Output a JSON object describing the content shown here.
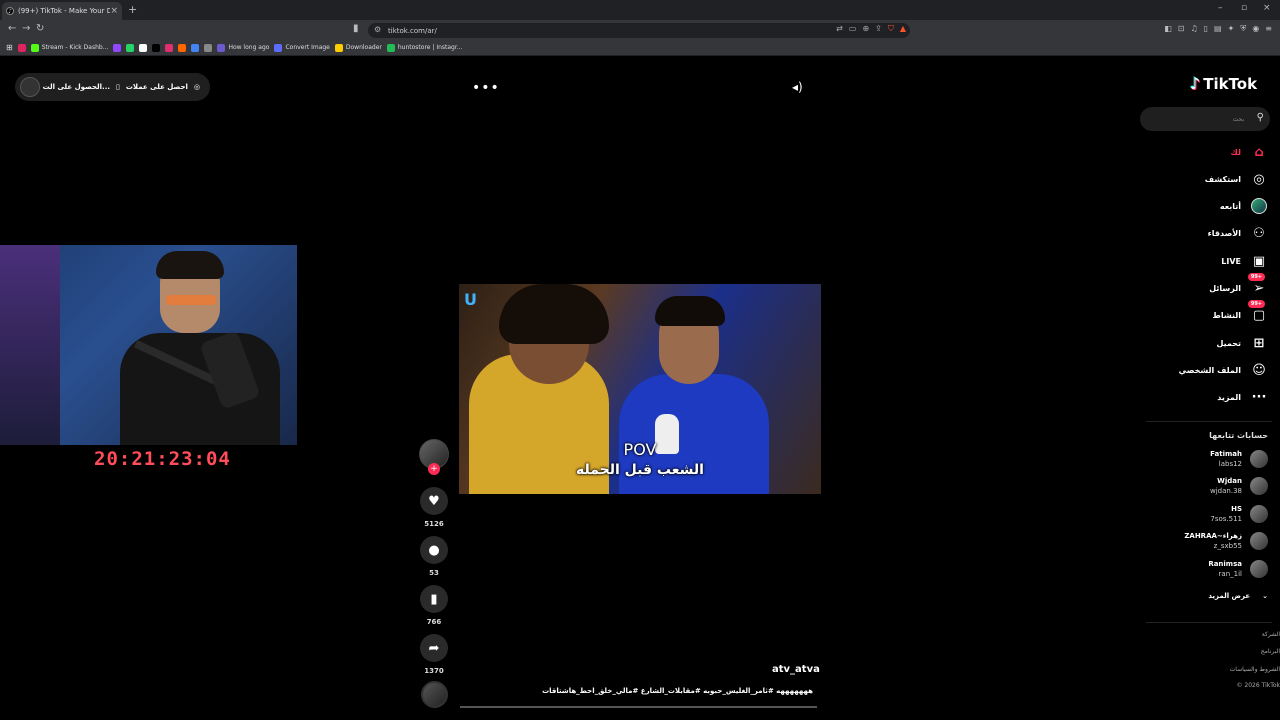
{
  "browser": {
    "tab_title": "(99+) TikTok - Make Your Day",
    "url": "tiktok.com/ar/",
    "bookmarks": [
      {
        "label": "",
        "color": "#e0245e"
      },
      {
        "label": "Stream - Kick Dashb...",
        "color": "#53fc18"
      },
      {
        "label": "",
        "color": "#9146ff"
      },
      {
        "label": "",
        "color": "#25d366"
      },
      {
        "label": "",
        "color": "#ffffff"
      },
      {
        "label": "",
        "color": "#000000"
      },
      {
        "label": "",
        "color": "#e1306c"
      },
      {
        "label": "",
        "color": "#ff6600"
      },
      {
        "label": "",
        "color": "#4285f4"
      },
      {
        "label": "",
        "color": "#888888"
      },
      {
        "label": "How long ago",
        "color": "#6a5acd"
      },
      {
        "label": "Convert Image",
        "color": "#5b6cff"
      },
      {
        "label": "Downloader",
        "color": "#ffcc00"
      },
      {
        "label": "huntostore | Instagr...",
        "color": "#22bb55"
      }
    ]
  },
  "overlay": {
    "coins_text": "احصل على عملات",
    "coins_text2": "الحصول على الت...",
    "clock": "20:21:23:04"
  },
  "video": {
    "caption_top": "POV",
    "caption_bottom": "الشعب قبل الحمله",
    "username": "atv_atva",
    "description": "هههههههه #ثامر_الغليس_حبوبه #مقابلات_الشارع #مالي_خلق_احط_هاشتاقات"
  },
  "actions": {
    "likes": "5126",
    "comments": "53",
    "saves": "766",
    "shares": "1370"
  },
  "sidebar": {
    "logo": "TikTok",
    "search_placeholder": "بحث",
    "nav": [
      {
        "label": "لك",
        "icon": "home-icon",
        "glyph": "⌂",
        "active": true,
        "badge": ""
      },
      {
        "label": "استكشف",
        "icon": "compass-icon",
        "glyph": "◎",
        "active": false,
        "badge": ""
      },
      {
        "label": "أتابعه",
        "icon": "avatar-icon",
        "glyph": "",
        "active": false,
        "badge": ""
      },
      {
        "label": "الأصدقاء",
        "icon": "friends-icon",
        "glyph": "⚇",
        "active": false,
        "badge": ""
      },
      {
        "label": "LIVE",
        "icon": "live-icon",
        "glyph": "▣",
        "active": false,
        "badge": ""
      },
      {
        "label": "الرسائل",
        "icon": "messages-icon",
        "glyph": "➢",
        "active": false,
        "badge": "99+"
      },
      {
        "label": "النشاط",
        "icon": "activity-icon",
        "glyph": "▢",
        "active": false,
        "badge": "99+"
      },
      {
        "label": "تحميل",
        "icon": "upload-icon",
        "glyph": "⊞",
        "active": false,
        "badge": ""
      },
      {
        "label": "الملف الشخصي",
        "icon": "profile-icon",
        "glyph": "☺",
        "active": false,
        "badge": ""
      },
      {
        "label": "المزيد",
        "icon": "more-icon",
        "glyph": "···",
        "active": false,
        "badge": ""
      }
    ],
    "following_title": "حسابات تتابعها",
    "following": [
      {
        "name": "Fatimah",
        "handle": "labs12"
      },
      {
        "name": "Wjdan",
        "handle": "wjdan.38"
      },
      {
        "name": "HS",
        "handle": "7sos.511"
      },
      {
        "name": "ZAHRAA~زهراء",
        "handle": "z_sxb55"
      },
      {
        "name": "Ranimsa",
        "handle": "ran_1il"
      }
    ],
    "see_more": "عرض المزيد",
    "footer": [
      "الشركة",
      "البرنامج",
      "الشروط والسياسات",
      "© 2026 TikTok"
    ]
  }
}
